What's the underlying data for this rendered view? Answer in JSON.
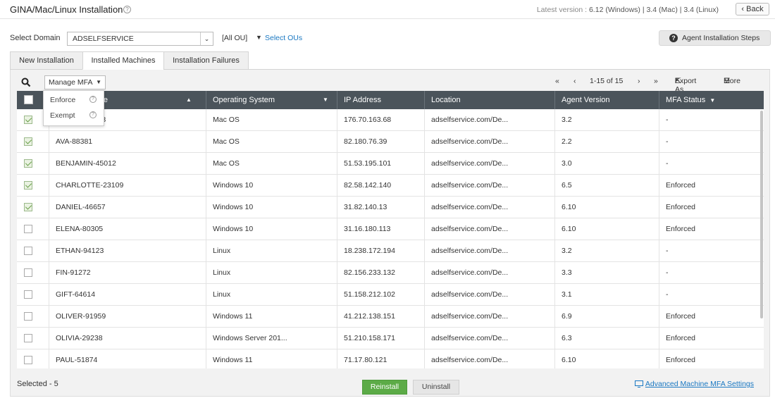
{
  "header": {
    "title": "GINA/Mac/Linux Installation",
    "latest_label": "Latest version :",
    "latest_value": "6.12 (Windows) | 3.4 (Mac) | 3.4 (Linux)",
    "back_label": "Back"
  },
  "domain": {
    "label": "Select Domain",
    "value": "ADSELFSERVICE",
    "all_ou": "[All OU]",
    "select_ous": "Select OUs",
    "agent_steps": "Agent Installation Steps"
  },
  "tabs": [
    {
      "label": "New Installation",
      "active": false
    },
    {
      "label": "Installed Machines",
      "active": true
    },
    {
      "label": "Installation Failures",
      "active": false
    }
  ],
  "toolbar": {
    "manage_mfa": "Manage MFA",
    "pager_range": "1-15 of 15",
    "export_label": "Export As",
    "more_label": "More"
  },
  "manage_mfa_menu": [
    "Enforce",
    "Exempt"
  ],
  "grid": {
    "columns": [
      "Machine Name",
      "Operating System",
      "IP Address",
      "Location",
      "Agent Version",
      "MFA Status"
    ],
    "rows": [
      {
        "checked": true,
        "name": "AMELIA-12993",
        "os": "Mac OS",
        "ip": "176.70.163.68",
        "location": "adselfservice.com/De...",
        "version": "3.2",
        "mfa": "-"
      },
      {
        "checked": true,
        "name": "AVA-88381",
        "os": "Mac OS",
        "ip": "82.180.76.39",
        "location": "adselfservice.com/De...",
        "version": "2.2",
        "mfa": "-"
      },
      {
        "checked": true,
        "name": "BENJAMIN-45012",
        "os": "Mac OS",
        "ip": "51.53.195.101",
        "location": "adselfservice.com/De...",
        "version": "3.0",
        "mfa": "-"
      },
      {
        "checked": true,
        "name": "CHARLOTTE-23109",
        "os": "Windows 10",
        "ip": "82.58.142.140",
        "location": "adselfservice.com/De...",
        "version": "6.5",
        "mfa": "Enforced"
      },
      {
        "checked": true,
        "name": "DANIEL-46657",
        "os": "Windows 10",
        "ip": "31.82.140.13",
        "location": "adselfservice.com/De...",
        "version": "6.10",
        "mfa": "Enforced"
      },
      {
        "checked": false,
        "name": "ELENA-80305",
        "os": "Windows 10",
        "ip": "31.16.180.113",
        "location": "adselfservice.com/De...",
        "version": "6.10",
        "mfa": "Enforced"
      },
      {
        "checked": false,
        "name": "ETHAN-94123",
        "os": "Linux",
        "ip": "18.238.172.194",
        "location": "adselfservice.com/De...",
        "version": "3.2",
        "mfa": "-"
      },
      {
        "checked": false,
        "name": "FIN-91272",
        "os": "Linux",
        "ip": "82.156.233.132",
        "location": "adselfservice.com/De...",
        "version": "3.3",
        "mfa": "-"
      },
      {
        "checked": false,
        "name": "GIFT-64614",
        "os": "Linux",
        "ip": "51.158.212.102",
        "location": "adselfservice.com/De...",
        "version": "3.1",
        "mfa": "-"
      },
      {
        "checked": false,
        "name": "OLIVER-91959",
        "os": "Windows 11",
        "ip": "41.212.138.151",
        "location": "adselfservice.com/De...",
        "version": "6.9",
        "mfa": "Enforced"
      },
      {
        "checked": false,
        "name": "OLIVIA-29238",
        "os": "Windows Server 201...",
        "ip": "51.210.158.171",
        "location": "adselfservice.com/De...",
        "version": "6.3",
        "mfa": "Enforced"
      },
      {
        "checked": false,
        "name": "PAUL-51874",
        "os": "Windows 11",
        "ip": "71.17.80.121",
        "location": "adselfservice.com/De...",
        "version": "6.10",
        "mfa": "Enforced"
      }
    ]
  },
  "footer": {
    "selected": "Selected - 5",
    "reinstall": "Reinstall",
    "uninstall": "Uninstall",
    "advanced_link": "Advanced Machine MFA Settings"
  },
  "colors": {
    "accent_link": "#1a78c2",
    "header_bg": "#4b545b",
    "reinstall_green": "#5cab47"
  }
}
